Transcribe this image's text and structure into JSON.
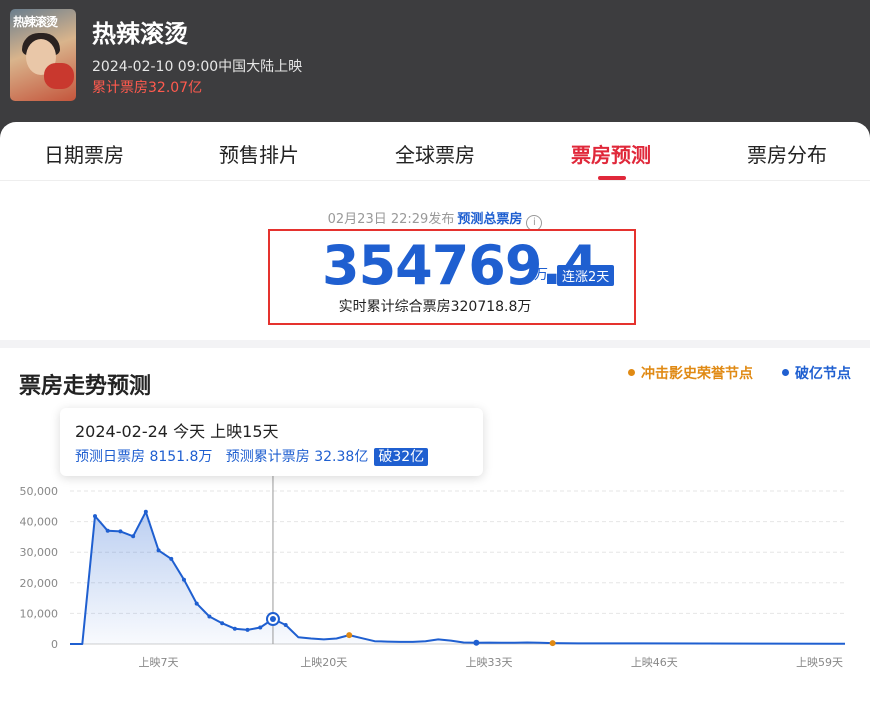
{
  "movie": {
    "poster_text": "热辣滚烫",
    "title": "热辣滚烫",
    "release": "2024-02-10 09:00中国大陆上映",
    "total_box_office": "累计票房32.07亿"
  },
  "tabs": [
    {
      "label": "日期票房",
      "active": false
    },
    {
      "label": "预售排片",
      "active": false
    },
    {
      "label": "全球票房",
      "active": false
    },
    {
      "label": "票房预测",
      "active": true
    },
    {
      "label": "票房分布",
      "active": false
    }
  ],
  "forecast": {
    "publish_time": "02月23日 22:29发布",
    "label": "预测总票房",
    "total": "354769.4",
    "unit": "万",
    "streak_badge": "连涨2天",
    "realtime": "实时累计综合票房320718.8万"
  },
  "trend": {
    "title": "票房走势预测",
    "legend_honor": "冲击影史荣誉节点",
    "legend_yi": "破亿节点"
  },
  "tooltip": {
    "line1": "2024-02-24 今天   上映15天",
    "daily": "预测日票房 8151.8万",
    "cumulative": "预测累计票房 32.38亿",
    "badge": "破32亿"
  },
  "colors": {
    "accent_red": "#e0283a",
    "accent_blue": "#1f5fd0",
    "honor_orange": "#e08a14",
    "header_bg": "#3d3d3f"
  },
  "chart_data": {
    "type": "area",
    "ylim": [
      0,
      50000
    ],
    "yticks": [
      "50,000",
      "40,000",
      "30,000",
      "20,000",
      "10,000",
      "0"
    ],
    "ytick_values": [
      50000,
      40000,
      30000,
      20000,
      10000,
      0
    ],
    "xtick_labels": [
      "上映7天",
      "上映20天",
      "上映33天",
      "上映46天",
      "上映59天"
    ],
    "xtick_days": [
      7,
      20,
      33,
      46,
      59
    ],
    "grid": true,
    "series": [
      {
        "x": [
          0,
          1,
          2,
          3,
          4,
          5,
          6,
          7,
          8,
          9,
          10,
          11,
          12,
          13,
          14,
          15,
          16,
          17,
          18,
          19,
          20,
          21,
          22,
          23,
          24,
          25,
          26,
          27,
          28,
          29,
          30,
          31,
          32,
          33,
          34,
          35,
          36,
          37,
          38,
          40,
          45,
          50,
          55,
          60,
          61
        ],
        "values": [
          0,
          0,
          41800,
          37000,
          36800,
          35200,
          43200,
          30600,
          27800,
          21000,
          13200,
          9000,
          6800,
          5000,
          4600,
          5400,
          8200,
          6200,
          2200,
          1800,
          1500,
          1800,
          2900,
          1900,
          900,
          800,
          700,
          700,
          900,
          1500,
          1100,
          500,
          400,
          450,
          400,
          400,
          500,
          400,
          300,
          200,
          200,
          150,
          120,
          100,
          100
        ]
      }
    ],
    "markers": [
      {
        "x": 16,
        "value": 8151.8,
        "kind": "today"
      },
      {
        "x": 22,
        "value": 2900,
        "kind": "honor"
      },
      {
        "x": 32,
        "value": 400,
        "kind": "yi"
      },
      {
        "x": 38,
        "value": 300,
        "kind": "honor"
      }
    ]
  }
}
